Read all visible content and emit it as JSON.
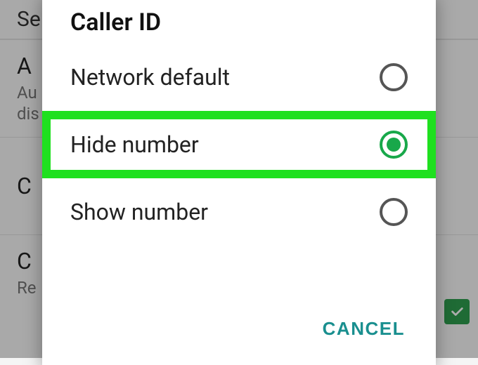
{
  "background": {
    "header": "Se",
    "items": [
      {
        "title": "A",
        "subtitle": "Au\ndis"
      },
      {
        "title": "C",
        "subtitle": ""
      },
      {
        "title": "C",
        "subtitle": "Re"
      }
    ]
  },
  "dialog": {
    "title": "Caller ID",
    "options": [
      {
        "id": "network-default",
        "label": "Network default",
        "selected": false,
        "highlighted": false
      },
      {
        "id": "hide-number",
        "label": "Hide number",
        "selected": true,
        "highlighted": true
      },
      {
        "id": "show-number",
        "label": "Show number",
        "selected": false,
        "highlighted": false
      }
    ],
    "cancel_label": "CANCEL"
  }
}
